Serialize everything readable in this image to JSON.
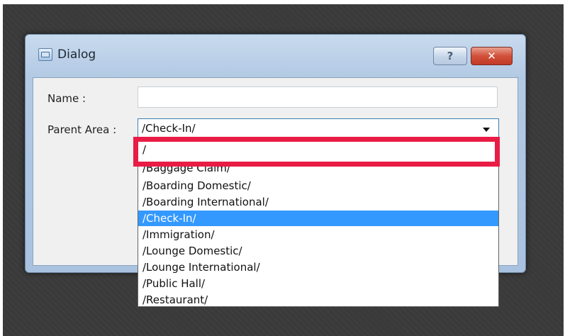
{
  "dialog": {
    "title": "Dialog",
    "icon": "window-icon",
    "help_label": "?",
    "close_label": "✕"
  },
  "form": {
    "name_label": "Name :",
    "name_value": "",
    "parent_area_label": "Parent Area :",
    "parent_area_value": "/Check-In/"
  },
  "dropdown": {
    "options": [
      "/",
      "/Baggage Claim/",
      "/Boarding Domestic/",
      "/Boarding International/",
      "/Check-In/",
      "/Immigration/",
      "/Lounge Domestic/",
      "/Lounge International/",
      "/Public Hall/",
      "/Restaurant/"
    ],
    "selected_index": 4
  },
  "colors": {
    "highlight_border": "#e81c45",
    "selection": "#3399ff"
  }
}
